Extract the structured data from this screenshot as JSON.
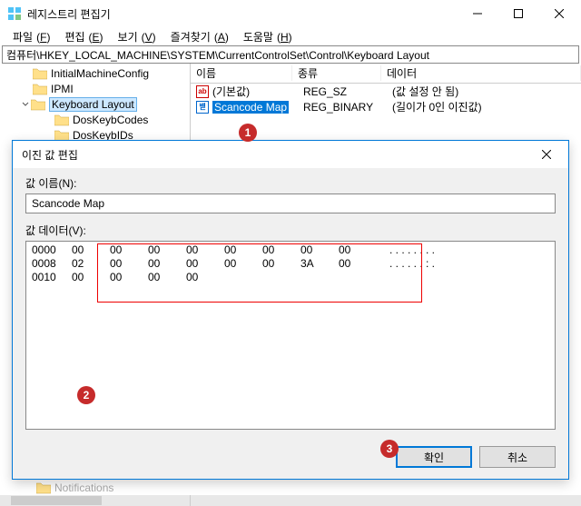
{
  "titlebar": {
    "title": "레지스트리 편집기"
  },
  "menubar": {
    "file": "파일",
    "file_u": "F",
    "edit": "편집",
    "edit_u": "E",
    "view": "보기",
    "view_u": "V",
    "fav": "즐겨찾기",
    "fav_u": "A",
    "help": "도움말",
    "help_u": "H"
  },
  "addressbar": "컴퓨터\\HKEY_LOCAL_MACHINE\\SYSTEM\\CurrentControlSet\\Control\\Keyboard Layout",
  "tree": {
    "items": [
      {
        "label": "InitialMachineConfig"
      },
      {
        "label": "IPMI"
      },
      {
        "label": "Keyboard Layout"
      },
      {
        "label": "DosKeybCodes"
      },
      {
        "label": "DosKeybIDs"
      },
      {
        "label": "Notifications"
      }
    ]
  },
  "list": {
    "headers": {
      "name": "이름",
      "type": "종류",
      "data": "데이터"
    },
    "rows": [
      {
        "icon": "ab",
        "name": "(기본값)",
        "type": "REG_SZ",
        "data": "(값 설정 안 됨)"
      },
      {
        "icon": "bin",
        "name": "Scancode Map",
        "type": "REG_BINARY",
        "data": "(길이가 0인 이진값)"
      }
    ]
  },
  "dialog": {
    "title": "이진 값 편집",
    "name_label": "값 이름(N):",
    "name_value": "Scancode Map",
    "data_label": "값 데이터(V):",
    "hex": {
      "rows": [
        {
          "offset": "0000",
          "bytes": [
            "00",
            "00",
            "00",
            "00",
            "00",
            "00",
            "00",
            "00"
          ],
          "ascii": ". . . . . . . ."
        },
        {
          "offset": "0008",
          "bytes": [
            "02",
            "00",
            "00",
            "00",
            "00",
            "00",
            "3A",
            "00"
          ],
          "ascii": ". . . . . . : ."
        },
        {
          "offset": "0010",
          "bytes": [
            "00",
            "00",
            "00",
            "00"
          ],
          "ascii": ""
        }
      ]
    },
    "ok": "확인",
    "cancel": "취소"
  },
  "badges": {
    "b1": "1",
    "b2": "2",
    "b3": "3"
  }
}
